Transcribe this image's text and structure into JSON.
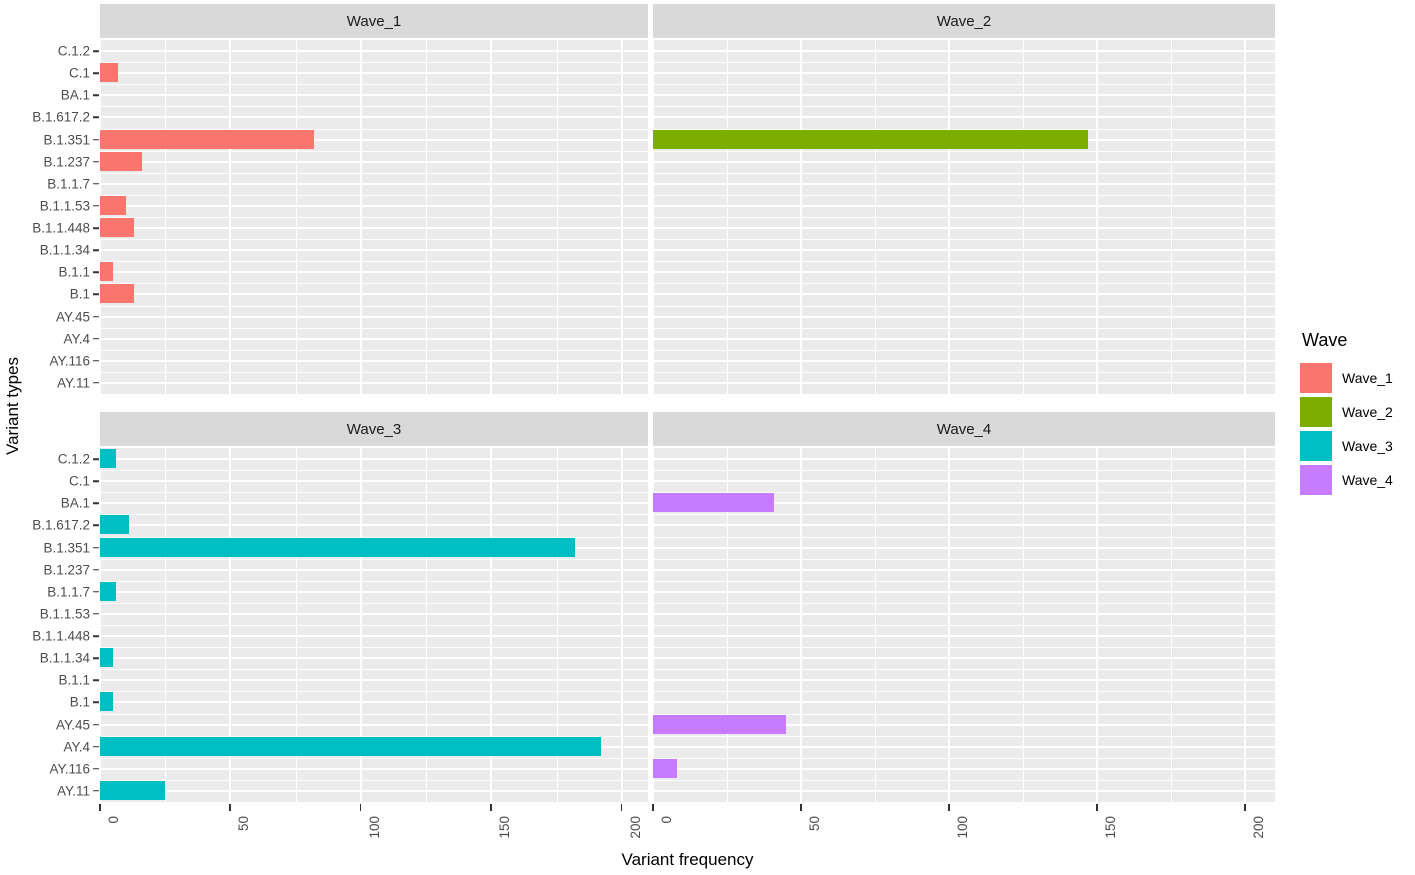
{
  "chart_data": {
    "type": "bar",
    "title": "",
    "xlabel": "Variant frequency",
    "ylabel": "Variant types",
    "xlim": [
      0,
      210
    ],
    "xticks": [
      "0",
      "50",
      "100",
      "150",
      "200"
    ],
    "xtick_values": [
      0,
      50,
      100,
      150,
      200
    ],
    "grid": true,
    "legend_position": "right",
    "legend_title": "Wave",
    "orientation": "horizontal",
    "facets": [
      "Wave_1",
      "Wave_2",
      "Wave_3",
      "Wave_4"
    ],
    "categories": [
      "C.1.2",
      "C.1",
      "BA.1",
      "B.1.617.2",
      "B.1.351",
      "B.1.237",
      "B.1.1.7",
      "B.1.1.53",
      "B.1.1.448",
      "B.1.1.34",
      "B.1.1",
      "B.1",
      "AY.45",
      "AY.4",
      "AY.116",
      "AY.11"
    ],
    "series": [
      {
        "name": "Wave_1",
        "color": "#f8766d",
        "values": [
          0,
          7,
          0,
          0,
          82,
          16,
          0,
          10,
          13,
          0,
          5,
          13,
          0,
          0,
          0,
          0
        ]
      },
      {
        "name": "Wave_2",
        "color": "#7cae00",
        "values": [
          0,
          0,
          0,
          0,
          147,
          0,
          0,
          0,
          0,
          0,
          0,
          0,
          0,
          0,
          0,
          0
        ]
      },
      {
        "name": "Wave_3",
        "color": "#00bfc4",
        "values": [
          6,
          0,
          0,
          11,
          182,
          0,
          6,
          0,
          0,
          5,
          0,
          5,
          0,
          192,
          0,
          25
        ]
      },
      {
        "name": "Wave_4",
        "color": "#c77cff",
        "values": [
          0,
          0,
          41,
          0,
          0,
          0,
          0,
          0,
          0,
          0,
          0,
          0,
          45,
          0,
          8,
          0
        ]
      }
    ]
  },
  "legend": {
    "title": "Wave",
    "items": [
      {
        "label": "Wave_1",
        "color": "#f8766d"
      },
      {
        "label": "Wave_2",
        "color": "#7cae00"
      },
      {
        "label": "Wave_3",
        "color": "#00bfc4"
      },
      {
        "label": "Wave_4",
        "color": "#c77cff"
      }
    ]
  },
  "axes": {
    "y_title": "Variant types",
    "x_title": "Variant frequency"
  }
}
